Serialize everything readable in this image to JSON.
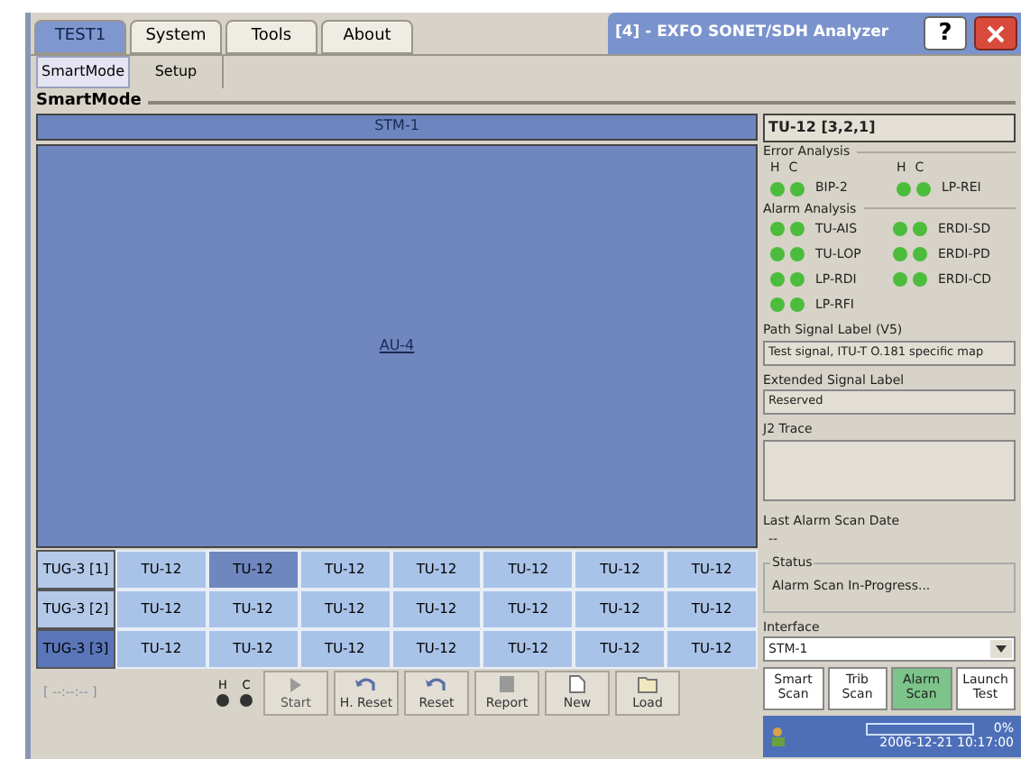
{
  "tabs": [
    {
      "label": "TEST1",
      "selected": true
    },
    {
      "label": "System",
      "selected": false
    },
    {
      "label": "Tools",
      "selected": false
    },
    {
      "label": "About",
      "selected": false
    }
  ],
  "window": {
    "title": "[4] - EXFO  SONET/SDH Analyzer",
    "help": "?"
  },
  "subtabs": [
    {
      "label": "SmartMode",
      "selected": true
    },
    {
      "label": "Setup",
      "selected": false
    }
  ],
  "section_title": "SmartMode",
  "stm_bar": "STM-1",
  "au_link": "AU-4",
  "grid": [
    {
      "label": "TUG-3 [1]",
      "selected": false,
      "cells": [
        {
          "label": "TU-12",
          "selected": false
        },
        {
          "label": "TU-12",
          "selected": true
        },
        {
          "label": "TU-12",
          "selected": false
        },
        {
          "label": "TU-12",
          "selected": false
        },
        {
          "label": "TU-12",
          "selected": false
        },
        {
          "label": "TU-12",
          "selected": false
        },
        {
          "label": "TU-12",
          "selected": false
        }
      ]
    },
    {
      "label": "TUG-3 [2]",
      "selected": false,
      "cells": [
        {
          "label": "TU-12",
          "selected": false
        },
        {
          "label": "TU-12",
          "selected": false
        },
        {
          "label": "TU-12",
          "selected": false
        },
        {
          "label": "TU-12",
          "selected": false
        },
        {
          "label": "TU-12",
          "selected": false
        },
        {
          "label": "TU-12",
          "selected": false
        },
        {
          "label": "TU-12",
          "selected": false
        }
      ]
    },
    {
      "label": "TUG-3 [3]",
      "selected": true,
      "cells": [
        {
          "label": "TU-12",
          "selected": false
        },
        {
          "label": "TU-12",
          "selected": false
        },
        {
          "label": "TU-12",
          "selected": false
        },
        {
          "label": "TU-12",
          "selected": false
        },
        {
          "label": "TU-12",
          "selected": false
        },
        {
          "label": "TU-12",
          "selected": false
        },
        {
          "label": "TU-12",
          "selected": false
        }
      ]
    }
  ],
  "toolbar": {
    "time": "[  --:--:--  ]",
    "leds": [
      {
        "label": "H",
        "on": false
      },
      {
        "label": "C",
        "on": false
      }
    ],
    "buttons": [
      {
        "label": "Start",
        "kind": "play",
        "disabled": true
      },
      {
        "label": "H. Reset",
        "kind": "undo",
        "disabled": false
      },
      {
        "label": "Reset",
        "kind": "undo",
        "disabled": false
      },
      {
        "label": "Report",
        "kind": "report",
        "disabled": false
      },
      {
        "label": "New",
        "kind": "new",
        "disabled": false
      },
      {
        "label": "Load",
        "kind": "load",
        "disabled": false
      }
    ]
  },
  "panel": {
    "title": "TU-12 [3,2,1]",
    "error_analysis": {
      "title": "Error Analysis",
      "headers": [
        "H",
        "C",
        "H",
        "C"
      ],
      "items": [
        {
          "label": "BIP-2",
          "h": true,
          "c": true
        },
        {
          "label": "LP-REI",
          "h": true,
          "c": true
        }
      ]
    },
    "alarm_analysis": {
      "title": "Alarm Analysis",
      "items": [
        {
          "label": "TU-AIS",
          "h": true,
          "c": true
        },
        {
          "label": "ERDI-SD",
          "h": true,
          "c": true
        },
        {
          "label": "TU-LOP",
          "h": true,
          "c": true
        },
        {
          "label": "ERDI-PD",
          "h": true,
          "c": true
        },
        {
          "label": "LP-RDI",
          "h": true,
          "c": true
        },
        {
          "label": "ERDI-CD",
          "h": true,
          "c": true
        },
        {
          "label": "LP-RFI",
          "h": true,
          "c": true
        }
      ]
    },
    "path_signal_label": {
      "label": "Path Signal Label (V5)",
      "value": "Test signal, ITU-T O.181 specific map"
    },
    "extended_signal_label": {
      "label": "Extended Signal Label",
      "value": "Reserved"
    },
    "j2_trace": {
      "label": "J2 Trace"
    },
    "last_scan": {
      "label": "Last Alarm Scan Date",
      "value": "--"
    },
    "status": {
      "label": "Status",
      "value": "Alarm Scan In-Progress..."
    },
    "interface": {
      "label": "Interface",
      "value": "STM-1"
    },
    "scan_buttons": [
      {
        "label": "Smart Scan",
        "selected": false
      },
      {
        "label": "Trib Scan",
        "selected": false
      },
      {
        "label": "Alarm Scan",
        "selected": true
      },
      {
        "label": "Launch Test",
        "selected": false
      }
    ]
  },
  "status_bar": {
    "progress": "0%",
    "level": 0,
    "datetime": "2006-12-21 10:17:00"
  }
}
